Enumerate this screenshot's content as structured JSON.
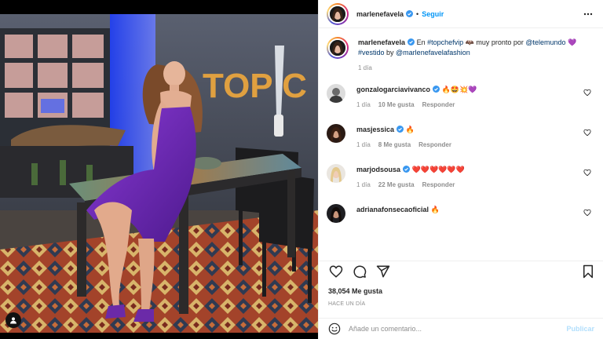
{
  "header": {
    "username": "marlenefavela",
    "separator": "•",
    "follow_label": "Seguir",
    "more_icon": "more-horizontal-icon"
  },
  "caption": {
    "username": "marlenefavela",
    "text_parts": [
      "En ",
      "#topchefvip",
      " 🦇 muy pronto por ",
      "@telemundo",
      " 💜"
    ],
    "line2_prefix": "#vestido",
    "line2_mid": " by ",
    "line2_link": "@marlenefavelafashion",
    "age": "1 día"
  },
  "comments": [
    {
      "username": "gonzalogarciavivanco",
      "verified": true,
      "text": "🔥🤩💥💜",
      "age": "1 día",
      "likes": "10 Me gusta",
      "reply": "Responder"
    },
    {
      "username": "masjessica",
      "verified": true,
      "text": "🔥",
      "age": "1 día",
      "likes": "8 Me gusta",
      "reply": "Responder"
    },
    {
      "username": "marjodsousa",
      "verified": true,
      "text": "❤️❤️❤️❤️❤️❤️",
      "age": "1 día",
      "likes": "22 Me gusta",
      "reply": "Responder"
    },
    {
      "username": "adrianafonsecaoficial",
      "verified": false,
      "text": "🔥",
      "age": "",
      "likes": "",
      "reply": ""
    }
  ],
  "actions": {
    "like_icon": "heart-icon",
    "comment_icon": "comment-icon",
    "share_icon": "share-icon",
    "save_icon": "bookmark-icon"
  },
  "likes": "38,054 Me gusta",
  "posted": "Hace un día",
  "add_comment": {
    "emoji_icon": "emoji-icon",
    "placeholder": "Añade un comentario...",
    "publish_label": "Publicar"
  },
  "photo": {
    "set_text": "TOP C",
    "alt": "photo"
  },
  "colors": {
    "accent": "#0095f6",
    "publish_disabled": "#b2dffc",
    "muted": "#8e8e8e",
    "link": "#00376b",
    "dress": "#6a2ab0"
  }
}
